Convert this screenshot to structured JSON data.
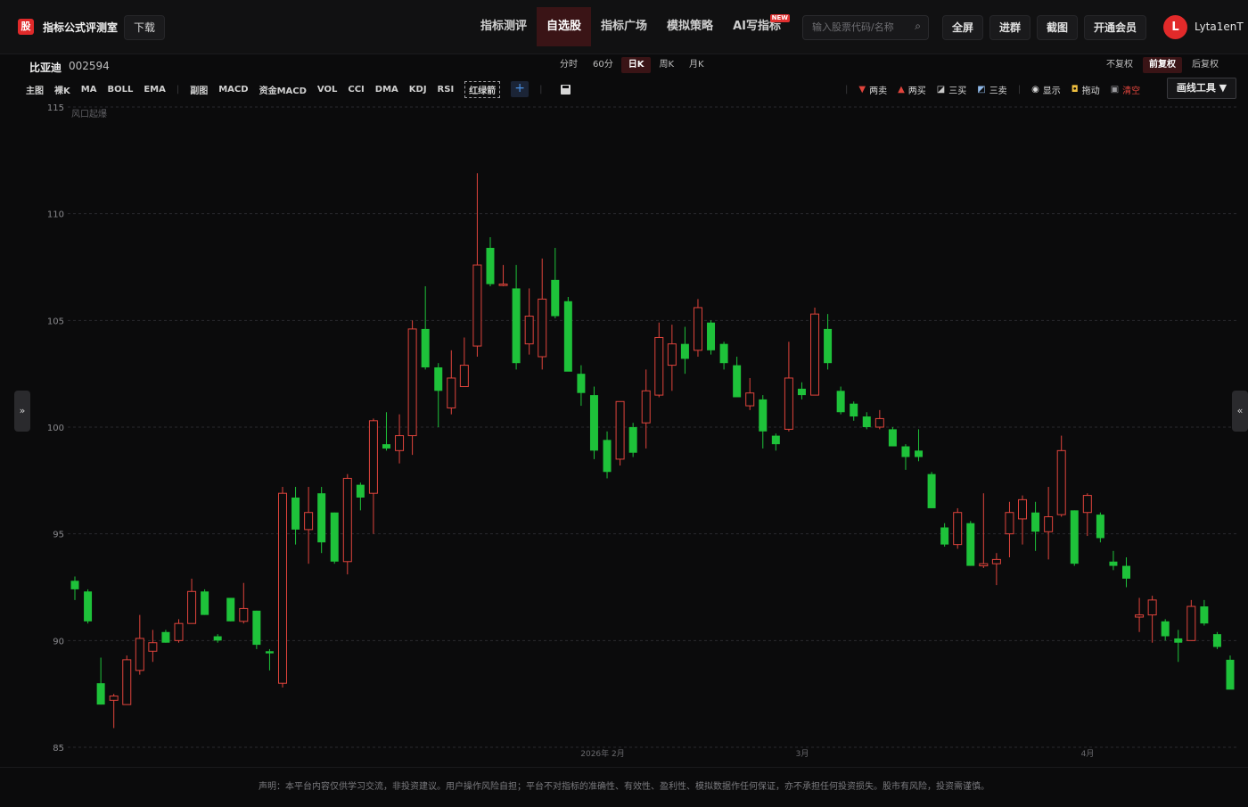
{
  "header": {
    "logo_char": "股",
    "app_title": "指标公式评测室",
    "download_label": "下载",
    "nav": [
      {
        "label": "指标测评",
        "active": false,
        "badge": ""
      },
      {
        "label": "自选股",
        "active": true,
        "badge": ""
      },
      {
        "label": "指标广场",
        "active": false,
        "badge": ""
      },
      {
        "label": "模拟策略",
        "active": false,
        "badge": ""
      },
      {
        "label": "AI写指标",
        "active": false,
        "badge": "NEW"
      }
    ],
    "search_placeholder": "输入股票代码/名称",
    "fullscreen_label": "全屏",
    "group_label": "进群",
    "screenshot_label": "截图",
    "vip_label": "开通会员",
    "avatar_letter": "L",
    "username": "Lyta1enT"
  },
  "stock": {
    "name": "比亚迪",
    "code": "002594"
  },
  "periods": [
    {
      "label": "分时",
      "active": false
    },
    {
      "label": "60分",
      "active": false
    },
    {
      "label": "日K",
      "active": true
    },
    {
      "label": "周K",
      "active": false
    },
    {
      "label": "月K",
      "active": false
    }
  ],
  "adjust": [
    {
      "label": "不复权",
      "active": false
    },
    {
      "label": "前复权",
      "active": true
    },
    {
      "label": "后复权",
      "active": false
    }
  ],
  "indicators_main": [
    "主图",
    "裸K",
    "MA",
    "BOLL",
    "EMA"
  ],
  "indicators_sub": [
    "副图",
    "MACD",
    "资金MACD",
    "VOL",
    "CCI",
    "DMA",
    "KDJ",
    "RSI"
  ],
  "indicator_boxed": "红绿箭",
  "tools": {
    "two_sell": "两卖",
    "two_buy": "两买",
    "three_buy": "三买",
    "three_sell": "三卖",
    "show": "显示",
    "drag": "拖动",
    "clear": "清空",
    "draw_tools": "画线工具 ▼"
  },
  "colors": {
    "up": "#e0443c",
    "down": "#1ec23a",
    "accent": "#e22a2a"
  },
  "chart_data": {
    "type": "candlestick",
    "annotation": "风口起爆",
    "ylim": [
      85,
      115
    ],
    "yticks": [
      85,
      90,
      95,
      100,
      105,
      110,
      115
    ],
    "xticks": [
      "2026年 2月",
      "3月",
      "4月"
    ],
    "candles": [
      {
        "o": 92.8,
        "h": 93.0,
        "l": 91.9,
        "c": 92.4
      },
      {
        "o": 92.3,
        "h": 92.4,
        "l": 90.8,
        "c": 90.9
      },
      {
        "o": 88.0,
        "h": 89.2,
        "l": 87.0,
        "c": 87.0
      },
      {
        "o": 87.2,
        "h": 87.5,
        "l": 85.9,
        "c": 87.4
      },
      {
        "o": 87.0,
        "h": 89.3,
        "l": 87.0,
        "c": 89.1
      },
      {
        "o": 88.6,
        "h": 91.2,
        "l": 88.4,
        "c": 90.1
      },
      {
        "o": 89.5,
        "h": 90.5,
        "l": 89.0,
        "c": 89.9
      },
      {
        "o": 90.4,
        "h": 90.5,
        "l": 89.9,
        "c": 89.9
      },
      {
        "o": 90.0,
        "h": 91.0,
        "l": 89.9,
        "c": 90.8
      },
      {
        "o": 90.8,
        "h": 92.9,
        "l": 90.8,
        "c": 92.3
      },
      {
        "o": 92.3,
        "h": 92.4,
        "l": 91.2,
        "c": 91.2
      },
      {
        "o": 90.2,
        "h": 90.3,
        "l": 89.9,
        "c": 90.0
      },
      {
        "o": 92.0,
        "h": 92.0,
        "l": 90.9,
        "c": 90.9
      },
      {
        "o": 90.9,
        "h": 92.7,
        "l": 90.8,
        "c": 91.5
      },
      {
        "o": 91.4,
        "h": 91.4,
        "l": 89.6,
        "c": 89.8
      },
      {
        "o": 89.5,
        "h": 89.6,
        "l": 88.6,
        "c": 89.4
      },
      {
        "o": 88.0,
        "h": 97.2,
        "l": 87.8,
        "c": 96.9
      },
      {
        "o": 96.7,
        "h": 97.2,
        "l": 94.5,
        "c": 95.2
      },
      {
        "o": 95.2,
        "h": 97.2,
        "l": 93.6,
        "c": 96.0
      },
      {
        "o": 96.9,
        "h": 97.2,
        "l": 94.1,
        "c": 94.6
      },
      {
        "o": 96.0,
        "h": 96.0,
        "l": 93.6,
        "c": 93.7
      },
      {
        "o": 93.7,
        "h": 97.8,
        "l": 93.1,
        "c": 97.6
      },
      {
        "o": 97.3,
        "h": 97.4,
        "l": 96.1,
        "c": 96.7
      },
      {
        "o": 96.9,
        "h": 100.4,
        "l": 95.0,
        "c": 100.3
      },
      {
        "o": 99.2,
        "h": 100.7,
        "l": 98.9,
        "c": 99.0
      },
      {
        "o": 98.9,
        "h": 100.6,
        "l": 98.3,
        "c": 99.6
      },
      {
        "o": 99.6,
        "h": 105.0,
        "l": 98.7,
        "c": 104.6
      },
      {
        "o": 104.6,
        "h": 106.6,
        "l": 102.7,
        "c": 102.8
      },
      {
        "o": 102.8,
        "h": 103.0,
        "l": 100.0,
        "c": 101.7
      },
      {
        "o": 100.9,
        "h": 103.6,
        "l": 100.6,
        "c": 102.3
      },
      {
        "o": 101.9,
        "h": 104.2,
        "l": 101.9,
        "c": 102.9
      },
      {
        "o": 103.8,
        "h": 111.9,
        "l": 103.3,
        "c": 107.6
      },
      {
        "o": 108.4,
        "h": 108.9,
        "l": 106.6,
        "c": 106.7
      },
      {
        "o": 106.7,
        "h": 107.6,
        "l": 106.6,
        "c": 106.7
      },
      {
        "o": 106.5,
        "h": 107.6,
        "l": 102.7,
        "c": 103.0
      },
      {
        "o": 103.9,
        "h": 106.5,
        "l": 103.4,
        "c": 105.2
      },
      {
        "o": 103.3,
        "h": 107.9,
        "l": 102.7,
        "c": 106.0
      },
      {
        "o": 106.9,
        "h": 108.4,
        "l": 105.1,
        "c": 105.2
      },
      {
        "o": 105.9,
        "h": 106.1,
        "l": 102.8,
        "c": 102.6
      },
      {
        "o": 102.5,
        "h": 102.9,
        "l": 101.0,
        "c": 101.6
      },
      {
        "o": 101.5,
        "h": 101.9,
        "l": 98.5,
        "c": 98.9
      },
      {
        "o": 99.4,
        "h": 99.8,
        "l": 97.6,
        "c": 97.9
      },
      {
        "o": 98.5,
        "h": 101.0,
        "l": 98.2,
        "c": 101.2
      },
      {
        "o": 100.0,
        "h": 100.2,
        "l": 98.6,
        "c": 98.8
      },
      {
        "o": 100.2,
        "h": 102.7,
        "l": 99.0,
        "c": 101.7
      },
      {
        "o": 101.5,
        "h": 104.9,
        "l": 101.4,
        "c": 104.2
      },
      {
        "o": 102.9,
        "h": 104.8,
        "l": 101.7,
        "c": 103.9
      },
      {
        "o": 103.9,
        "h": 104.7,
        "l": 102.5,
        "c": 103.2
      },
      {
        "o": 103.6,
        "h": 106.0,
        "l": 103.3,
        "c": 105.6
      },
      {
        "o": 104.9,
        "h": 105.0,
        "l": 103.4,
        "c": 103.6
      },
      {
        "o": 103.9,
        "h": 104.0,
        "l": 102.7,
        "c": 103.0
      },
      {
        "o": 102.9,
        "h": 103.3,
        "l": 101.4,
        "c": 101.4
      },
      {
        "o": 101.0,
        "h": 102.3,
        "l": 100.8,
        "c": 101.6
      },
      {
        "o": 101.3,
        "h": 101.5,
        "l": 99.0,
        "c": 99.8
      },
      {
        "o": 99.6,
        "h": 99.7,
        "l": 98.9,
        "c": 99.2
      },
      {
        "o": 99.9,
        "h": 104.0,
        "l": 99.8,
        "c": 102.3
      },
      {
        "o": 101.8,
        "h": 102.1,
        "l": 101.3,
        "c": 101.5
      },
      {
        "o": 101.5,
        "h": 105.6,
        "l": 101.5,
        "c": 105.3
      },
      {
        "o": 104.6,
        "h": 105.3,
        "l": 102.7,
        "c": 103.0
      },
      {
        "o": 101.7,
        "h": 101.9,
        "l": 100.6,
        "c": 100.7
      },
      {
        "o": 101.1,
        "h": 101.2,
        "l": 100.3,
        "c": 100.5
      },
      {
        "o": 100.5,
        "h": 100.7,
        "l": 99.9,
        "c": 100.0
      },
      {
        "o": 100.0,
        "h": 100.8,
        "l": 99.9,
        "c": 100.4
      },
      {
        "o": 99.9,
        "h": 100.0,
        "l": 99.1,
        "c": 99.1
      },
      {
        "o": 99.1,
        "h": 99.2,
        "l": 98.0,
        "c": 98.6
      },
      {
        "o": 98.9,
        "h": 99.9,
        "l": 98.4,
        "c": 98.6
      },
      {
        "o": 97.8,
        "h": 97.9,
        "l": 96.2,
        "c": 96.2
      },
      {
        "o": 95.3,
        "h": 95.5,
        "l": 94.4,
        "c": 94.5
      },
      {
        "o": 94.5,
        "h": 96.2,
        "l": 94.3,
        "c": 96.0
      },
      {
        "o": 95.5,
        "h": 95.6,
        "l": 93.5,
        "c": 93.5
      },
      {
        "o": 93.5,
        "h": 96.9,
        "l": 93.4,
        "c": 93.6
      },
      {
        "o": 93.6,
        "h": 94.1,
        "l": 92.6,
        "c": 93.8
      },
      {
        "o": 95.0,
        "h": 96.5,
        "l": 93.9,
        "c": 96.0
      },
      {
        "o": 95.7,
        "h": 96.8,
        "l": 94.5,
        "c": 96.6
      },
      {
        "o": 96.0,
        "h": 96.5,
        "l": 94.2,
        "c": 95.1
      },
      {
        "o": 95.1,
        "h": 97.2,
        "l": 93.8,
        "c": 95.8
      },
      {
        "o": 95.9,
        "h": 99.6,
        "l": 95.8,
        "c": 98.9
      },
      {
        "o": 96.1,
        "h": 96.1,
        "l": 93.5,
        "c": 93.6
      },
      {
        "o": 96.0,
        "h": 96.9,
        "l": 94.9,
        "c": 96.8
      },
      {
        "o": 95.9,
        "h": 96.0,
        "l": 94.6,
        "c": 94.8
      },
      {
        "o": 93.7,
        "h": 94.2,
        "l": 93.3,
        "c": 93.5
      },
      {
        "o": 93.5,
        "h": 93.9,
        "l": 92.5,
        "c": 92.9
      },
      {
        "o": 91.1,
        "h": 92.0,
        "l": 90.4,
        "c": 91.2
      },
      {
        "o": 91.2,
        "h": 92.1,
        "l": 89.9,
        "c": 91.9
      },
      {
        "o": 90.9,
        "h": 91.0,
        "l": 90.0,
        "c": 90.2
      },
      {
        "o": 90.1,
        "h": 90.5,
        "l": 89.0,
        "c": 89.9
      },
      {
        "o": 90.0,
        "h": 91.9,
        "l": 90.0,
        "c": 91.6
      },
      {
        "o": 91.6,
        "h": 91.9,
        "l": 90.7,
        "c": 90.8
      },
      {
        "o": 90.3,
        "h": 90.4,
        "l": 89.6,
        "c": 89.7
      },
      {
        "o": 89.1,
        "h": 89.3,
        "l": 87.8,
        "c": 87.7
      }
    ]
  },
  "footer": "声明：本平台内容仅供学习交流，非投资建议。用户操作风险自担；平台不对指标的准确性、有效性、盈利性、模拟数据作任何保证，亦不承担任何投资损失。股市有风险，投资需谨慎。"
}
